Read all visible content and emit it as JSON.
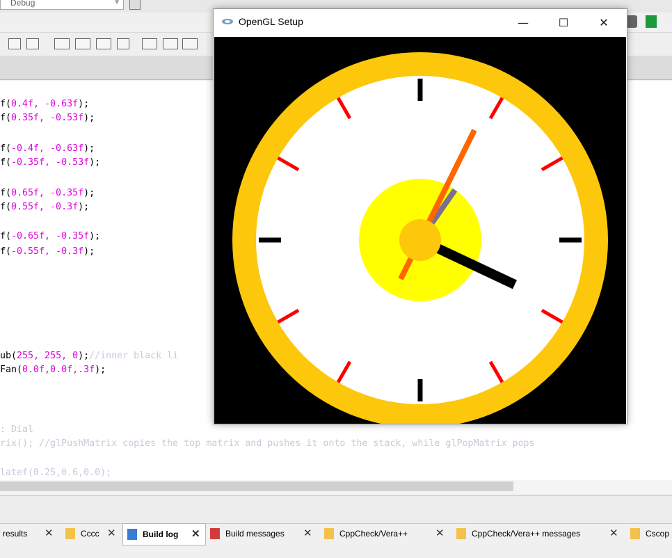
{
  "ide": {
    "build_target": "Debug",
    "code_lines": [
      {
        "prefix": "f(",
        "args": "0.4f, -0.63f",
        "suffix": ");"
      },
      {
        "prefix": "f(",
        "args": "0.35f, -0.53f",
        "suffix": ");"
      },
      {
        "prefix": "f(",
        "args": "-0.4f, -0.63f",
        "suffix": ");"
      },
      {
        "prefix": "f(",
        "args": "-0.35f, -0.53f",
        "suffix": ");"
      },
      {
        "prefix": "f(",
        "args": "0.65f, -0.35f",
        "suffix": ");"
      },
      {
        "prefix": "f(",
        "args": "0.55f, -0.3f",
        "suffix": ");"
      },
      {
        "prefix": "f(",
        "args": "-0.65f, -0.35f",
        "suffix": ");"
      },
      {
        "prefix": "f(",
        "args": "-0.55f, -0.3f",
        "suffix": ");"
      }
    ],
    "color_line": {
      "prefix": "ub(",
      "args": "255, 255, 0",
      "suffix": ");",
      "comment": "//inner black li"
    },
    "fan_line": {
      "prefix": "Fan(",
      "args": "0.0f,0.0f,.3f",
      "suffix": ");"
    },
    "faded_lines": [
      ": Dial",
      "rix(); //glPushMatrix copies the top matrix and pushes it onto the stack, while glPopMatrix pops",
      "latef(0.25,0.6,0.0);"
    ],
    "bottom_tabs": [
      {
        "label": "results",
        "active": false
      },
      {
        "label": "Cccc",
        "active": false
      },
      {
        "label": "Build log",
        "active": true
      },
      {
        "label": "Build messages",
        "active": false
      },
      {
        "label": "CppCheck/Vera++",
        "active": false
      },
      {
        "label": "CppCheck/Vera++ messages",
        "active": false
      },
      {
        "label": "Cscop",
        "active": false
      }
    ]
  },
  "gl_window": {
    "title": "OpenGL Setup",
    "minimize_glyph": "—",
    "maximize_glyph": "☐",
    "close_glyph": "✕"
  },
  "colors": {
    "clock_rim": "#fdc70c",
    "clock_face": "#ffffff",
    "center_disc": "#ffff00",
    "hub": "#fdc70c",
    "major_tick": "#000000",
    "minor_tick": "#ff0000",
    "minute_hand": "#ff6600",
    "second_hand": "#7a7090",
    "hour_hand": "#000000",
    "background": "#000000"
  }
}
